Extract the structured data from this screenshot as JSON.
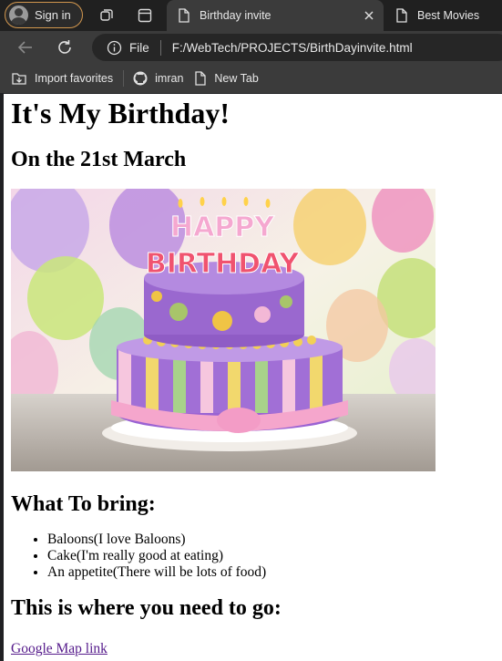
{
  "browser": {
    "signin_label": "Sign in",
    "tabs": [
      {
        "title": "Birthday invite",
        "active": true
      },
      {
        "title": "Best Movies",
        "active": false
      }
    ],
    "address": {
      "scheme_label": "File",
      "url": "F:/WebTech/PROJECTS/BirthDayinvite.html"
    },
    "favorites": [
      {
        "label": "Import favorites",
        "icon": "import-favorites-icon"
      },
      {
        "label": "imran",
        "icon": "github-icon"
      },
      {
        "label": "New Tab",
        "icon": "document-icon"
      }
    ],
    "colors": {
      "chrome_dark": "#202020",
      "toolbar": "#3b3b3b",
      "signin_border": "#d2974e",
      "visited_link": "#551a8b"
    }
  },
  "page": {
    "heading": "It's My Birthday!",
    "date_line": "On the 21st March",
    "image_alt": "Happy Birthday cake",
    "cake_text_happy": "HAPPY",
    "cake_text_birthday": "BIRTHDAY",
    "bring_heading": "What To bring:",
    "bring_items": [
      "Baloons(I love Baloons)",
      "Cake(I'm really good at eating)",
      "An appetite(There will be lots of food)"
    ],
    "go_heading": "This is where you need to go:",
    "map_link": "Google Map link"
  }
}
